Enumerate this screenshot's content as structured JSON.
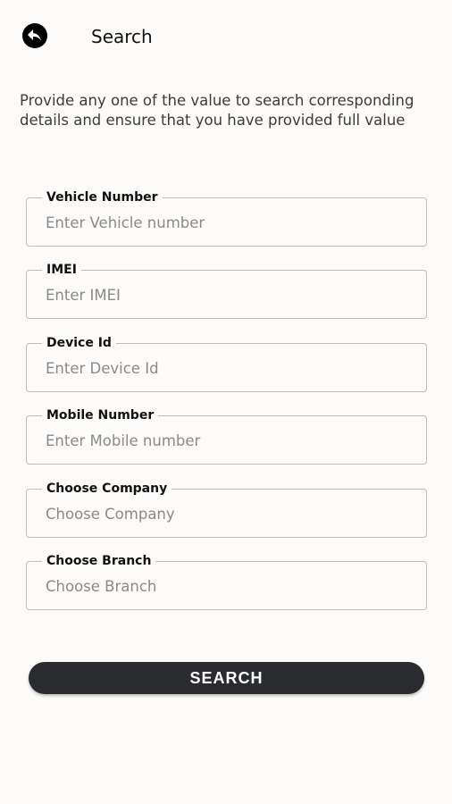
{
  "header": {
    "back_icon": "back-arrow-icon",
    "title": "Search"
  },
  "description": "Provide any one of the value to search corresponding details and ensure that you have provided full value",
  "fields": [
    {
      "label": "Vehicle Number",
      "placeholder": "Enter Vehicle number",
      "value": ""
    },
    {
      "label": "IMEI",
      "placeholder": "Enter IMEI",
      "value": ""
    },
    {
      "label": "Device Id",
      "placeholder": "Enter Device Id",
      "value": ""
    },
    {
      "label": "Mobile Number",
      "placeholder": "Enter Mobile number",
      "value": ""
    },
    {
      "label": "Choose Company",
      "placeholder": "Choose Company",
      "value": ""
    },
    {
      "label": "Choose Branch",
      "placeholder": "Choose Branch",
      "value": ""
    }
  ],
  "search_button": {
    "label": "SEARCH"
  },
  "colors": {
    "background": "#fcfbf9",
    "button": "#2a2b2e",
    "border": "#bdbdbd"
  }
}
